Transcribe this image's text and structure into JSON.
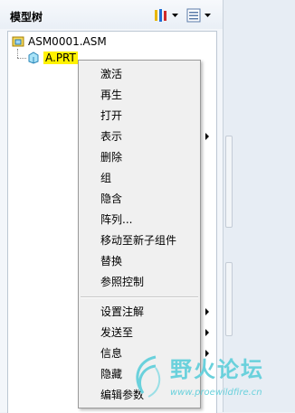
{
  "panel": {
    "title": "模型树",
    "tools": [
      {
        "icon": "settings-tools-icon"
      },
      {
        "icon": "list-settings-icon"
      }
    ]
  },
  "tree": {
    "root_label": "ASM0001.ASM",
    "child_label": "A.PRT"
  },
  "context_menu": {
    "items": [
      {
        "label": "激活"
      },
      {
        "label": "再生"
      },
      {
        "label": "打开"
      },
      {
        "label": "表示"
      },
      {
        "label": "删除"
      },
      {
        "label": "组"
      },
      {
        "label": "隐含"
      },
      {
        "label": "阵列..."
      },
      {
        "label": "移动至新子组件"
      },
      {
        "label": "替换"
      },
      {
        "label": "参照控制"
      },
      {
        "label": "设置注解"
      },
      {
        "label": "发送至"
      },
      {
        "label": "信息"
      },
      {
        "label": "隐藏"
      },
      {
        "label": "编辑参数"
      }
    ]
  },
  "watermark": {
    "title": "野火论坛",
    "url": "www.proewildfire.cn"
  },
  "colors": {
    "selection": "#fff200",
    "menu_bg": "#f0f0f0",
    "watermark": "#6ad1dc"
  }
}
